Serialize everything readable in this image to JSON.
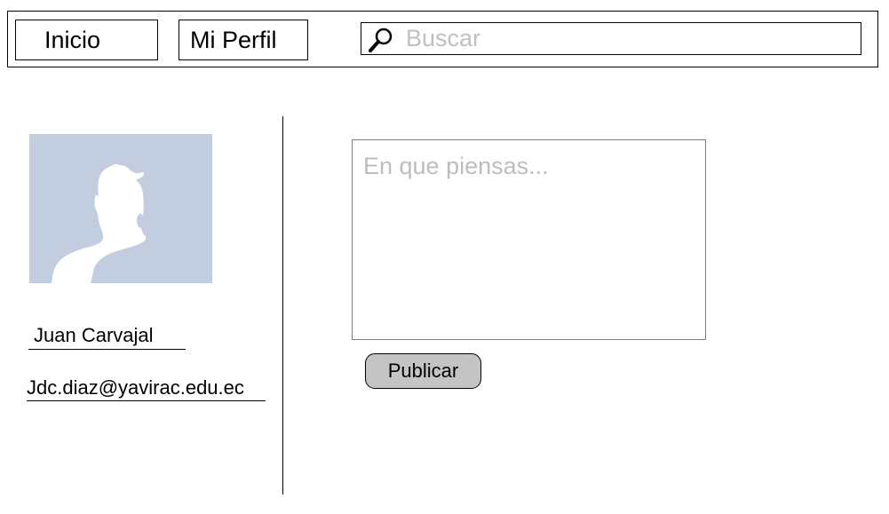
{
  "nav": {
    "home_label": "Inicio",
    "profile_label": "Mi Perfil"
  },
  "search": {
    "placeholder": "Buscar",
    "value": "",
    "icon": "magnifier-icon"
  },
  "profile": {
    "avatar_icon": "default-user-silhouette",
    "name": "Juan Carvajal",
    "email": "Jdc.diaz@yavirac.edu.ec"
  },
  "composer": {
    "placeholder": "En que piensas...",
    "value": "",
    "publish_label": "Publicar"
  },
  "colors": {
    "avatar_background": "#c2cde0",
    "avatar_silhouette": "#ffffff",
    "button_fill": "#c4c4c4",
    "placeholder_text": "#c0c0c0",
    "border": "#000000"
  }
}
